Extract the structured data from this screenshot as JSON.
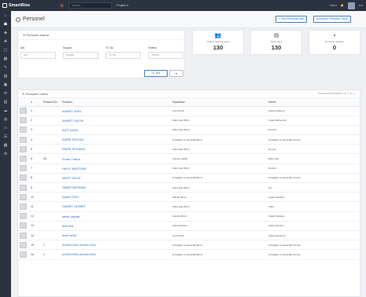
{
  "topbar": {
    "brand": "SmartRise",
    "search_placeholder": "Arama...",
    "project_label": "Projeler ▾",
    "lang": "Her ▾",
    "user": "● ▾"
  },
  "sidebar": {
    "icons": [
      "home-icon",
      "users-icon",
      "user-icon",
      "user-add-icon",
      "file-icon",
      "chart-icon",
      "wrench-icon",
      "file-text-icon",
      "calendar-icon",
      "mail-icon",
      "bar-chart-icon",
      "cloud-icon",
      "globe-icon",
      "monitor-icon",
      "list-icon",
      "building-icon",
      "settings-icon"
    ]
  },
  "page": {
    "title": "Personel",
    "btn_new": "+ Yeni Personel Ekle",
    "btn_excel": "Excel'den Personel Yükle"
  },
  "filter": {
    "title": "Personel Arama",
    "fields": [
      {
        "label": "Adı",
        "placeholder": "Adı"
      },
      {
        "label": "Soyadı",
        "placeholder": "Soyadı"
      },
      {
        "label": "TC No",
        "placeholder": "TC No"
      },
      {
        "label": "Telefon",
        "placeholder": "Telefon"
      }
    ],
    "search_btn": "🔍 Ara",
    "toggle_btn": "▾"
  },
  "stats": [
    {
      "icon": "group-icon",
      "label": "Toplam Aktif Personel",
      "value": "130"
    },
    {
      "icon": "document-icon",
      "label": "Sicile Kayıt",
      "value": "130"
    },
    {
      "icon": "briefcase-icon",
      "label": "Personel Çalışanı",
      "value": "0"
    }
  ],
  "table": {
    "title": "Personel Listesi",
    "right_label": "Personel Seçenekleri  ▸  ⚙ ⇪ ⊞ ⊟",
    "columns": [
      "#",
      "Personel No",
      "Personel",
      "Departman",
      "Görevi"
    ],
    "rows": [
      {
        "idx": "1",
        "no": "",
        "name": "AHMET AYRI",
        "dept": "Civil Works",
        "role": "Ahşap Kalıpçısı"
      },
      {
        "idx": "2",
        "no": "",
        "name": "AHMET SAYIN",
        "dept": "Kaba İşler Birimi",
        "role": "İnşaat Mühendisi"
      },
      {
        "idx": "3",
        "no": "",
        "name": "AZİZ KAYA",
        "dept": "Kaba İşler Birimi",
        "role": "Demirci"
      },
      {
        "idx": "4",
        "no": "",
        "name": "EMRE ERGÜN",
        "dept": "İş Sağlığı ve Güvenliği Birimi",
        "role": "İş Sağlığı ve Güvenliği Uzmanı"
      },
      {
        "idx": "5",
        "no": "",
        "name": "EMRE SOLMAZ",
        "dept": "Kaba İşler Birimi",
        "role": "Demirci"
      },
      {
        "idx": "6",
        "no": "26",
        "name": "Ercan Turkut",
        "dept": "Santiye Şefliği",
        "role": "Bilgi Lider"
      },
      {
        "idx": "7",
        "no": "",
        "name": "HALİL BAŞTÜRK",
        "dept": "Kaba İşler Birimi",
        "role": "Demirci"
      },
      {
        "idx": "8",
        "no": "",
        "name": "MERT SELVİ",
        "dept": "İş Sağlığı ve Güvenliği Birimi",
        "role": "İş Sağlığı ve Güvenliği Uzmanı"
      },
      {
        "idx": "9",
        "no": "",
        "name": "ÖMER BAYRAM",
        "dept": "Kaba İşler Birimi",
        "role": "İşçi"
      },
      {
        "idx": "10",
        "no": "",
        "name": "Şahin ÖZEL",
        "dept": "İdareliş Birimi",
        "role": "İnşaat Teknikeri"
      },
      {
        "idx": "11",
        "no": "",
        "name": "SAMET GÜNER",
        "dept": "Kaba İşler Birimi",
        "role": "Kalfa"
      },
      {
        "idx": "12",
        "no": "",
        "name": "selim caydar",
        "dept": "İdareliş Birimi",
        "role": "İnşaat Teknikeri"
      },
      {
        "idx": "13",
        "no": "",
        "name": "test test",
        "dept": "Administrative",
        "role": "Ahşap Demirci"
      },
      {
        "idx": "14",
        "no": "",
        "name": "test2 test2",
        "dept": "Civil Works",
        "role": "Ahşap Demircisi"
      },
      {
        "idx": "15",
        "no": "1",
        "name": "wUmrLVWz wUmrLVWz",
        "dept": "İş Sağlığı ve Güvenliği Birimi",
        "role": "İş Sağlığı ve Güvenliği Uzmanı"
      },
      {
        "idx": "16",
        "no": "1",
        "name": "wUmrLVWz wUmrLVWz",
        "dept": "İş Sağlığı ve Güvenliği Birimi",
        "role": "İş Sağlığı ve Güvenliği Uzmanı"
      }
    ]
  }
}
